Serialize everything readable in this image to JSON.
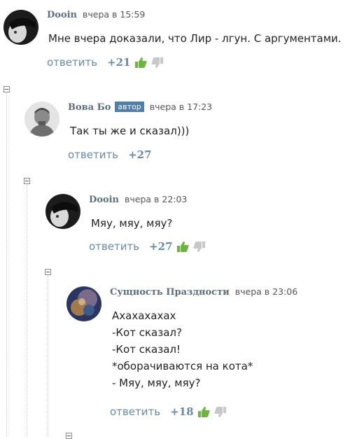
{
  "comments": [
    {
      "author": "Dooin",
      "time": "вчера в 15:59",
      "text_lines": [
        "Мне вчера доказали, что Лир - лгун. С аргументами."
      ],
      "reply_label": "ответить",
      "score": "+21",
      "show_votes": true
    },
    {
      "author": "Вова Бо",
      "badge": "автор",
      "time": "вчера в 17:23",
      "text_lines": [
        "Так ты же и сказал)))"
      ],
      "reply_label": "ответить",
      "score": "+27",
      "show_votes": false
    },
    {
      "author": "Dooin",
      "time": "вчера в 22:03",
      "text_lines": [
        "Мяу, мяу, мяу?"
      ],
      "reply_label": "ответить",
      "score": "+27",
      "show_votes": true
    },
    {
      "author": "Сущность Праздности",
      "time": "вчера в 23:06",
      "text_lines": [
        "Ахахахахах",
        "-Кот сказал?",
        "-Кот сказал!",
        "*оборачиваются на кота*",
        "- Мяу, мяу, мяу?"
      ],
      "reply_label": "ответить",
      "score": "+18",
      "show_votes": true
    }
  ],
  "colors": {
    "author": "#5d6e7c",
    "link": "#6889a6",
    "badge": "#4f7ea9",
    "upvote": "#6db33f",
    "downvote": "#c8c8c8"
  },
  "icons": [
    "thumbs-up-icon",
    "thumbs-down-icon",
    "collapse-toggle-icon"
  ]
}
